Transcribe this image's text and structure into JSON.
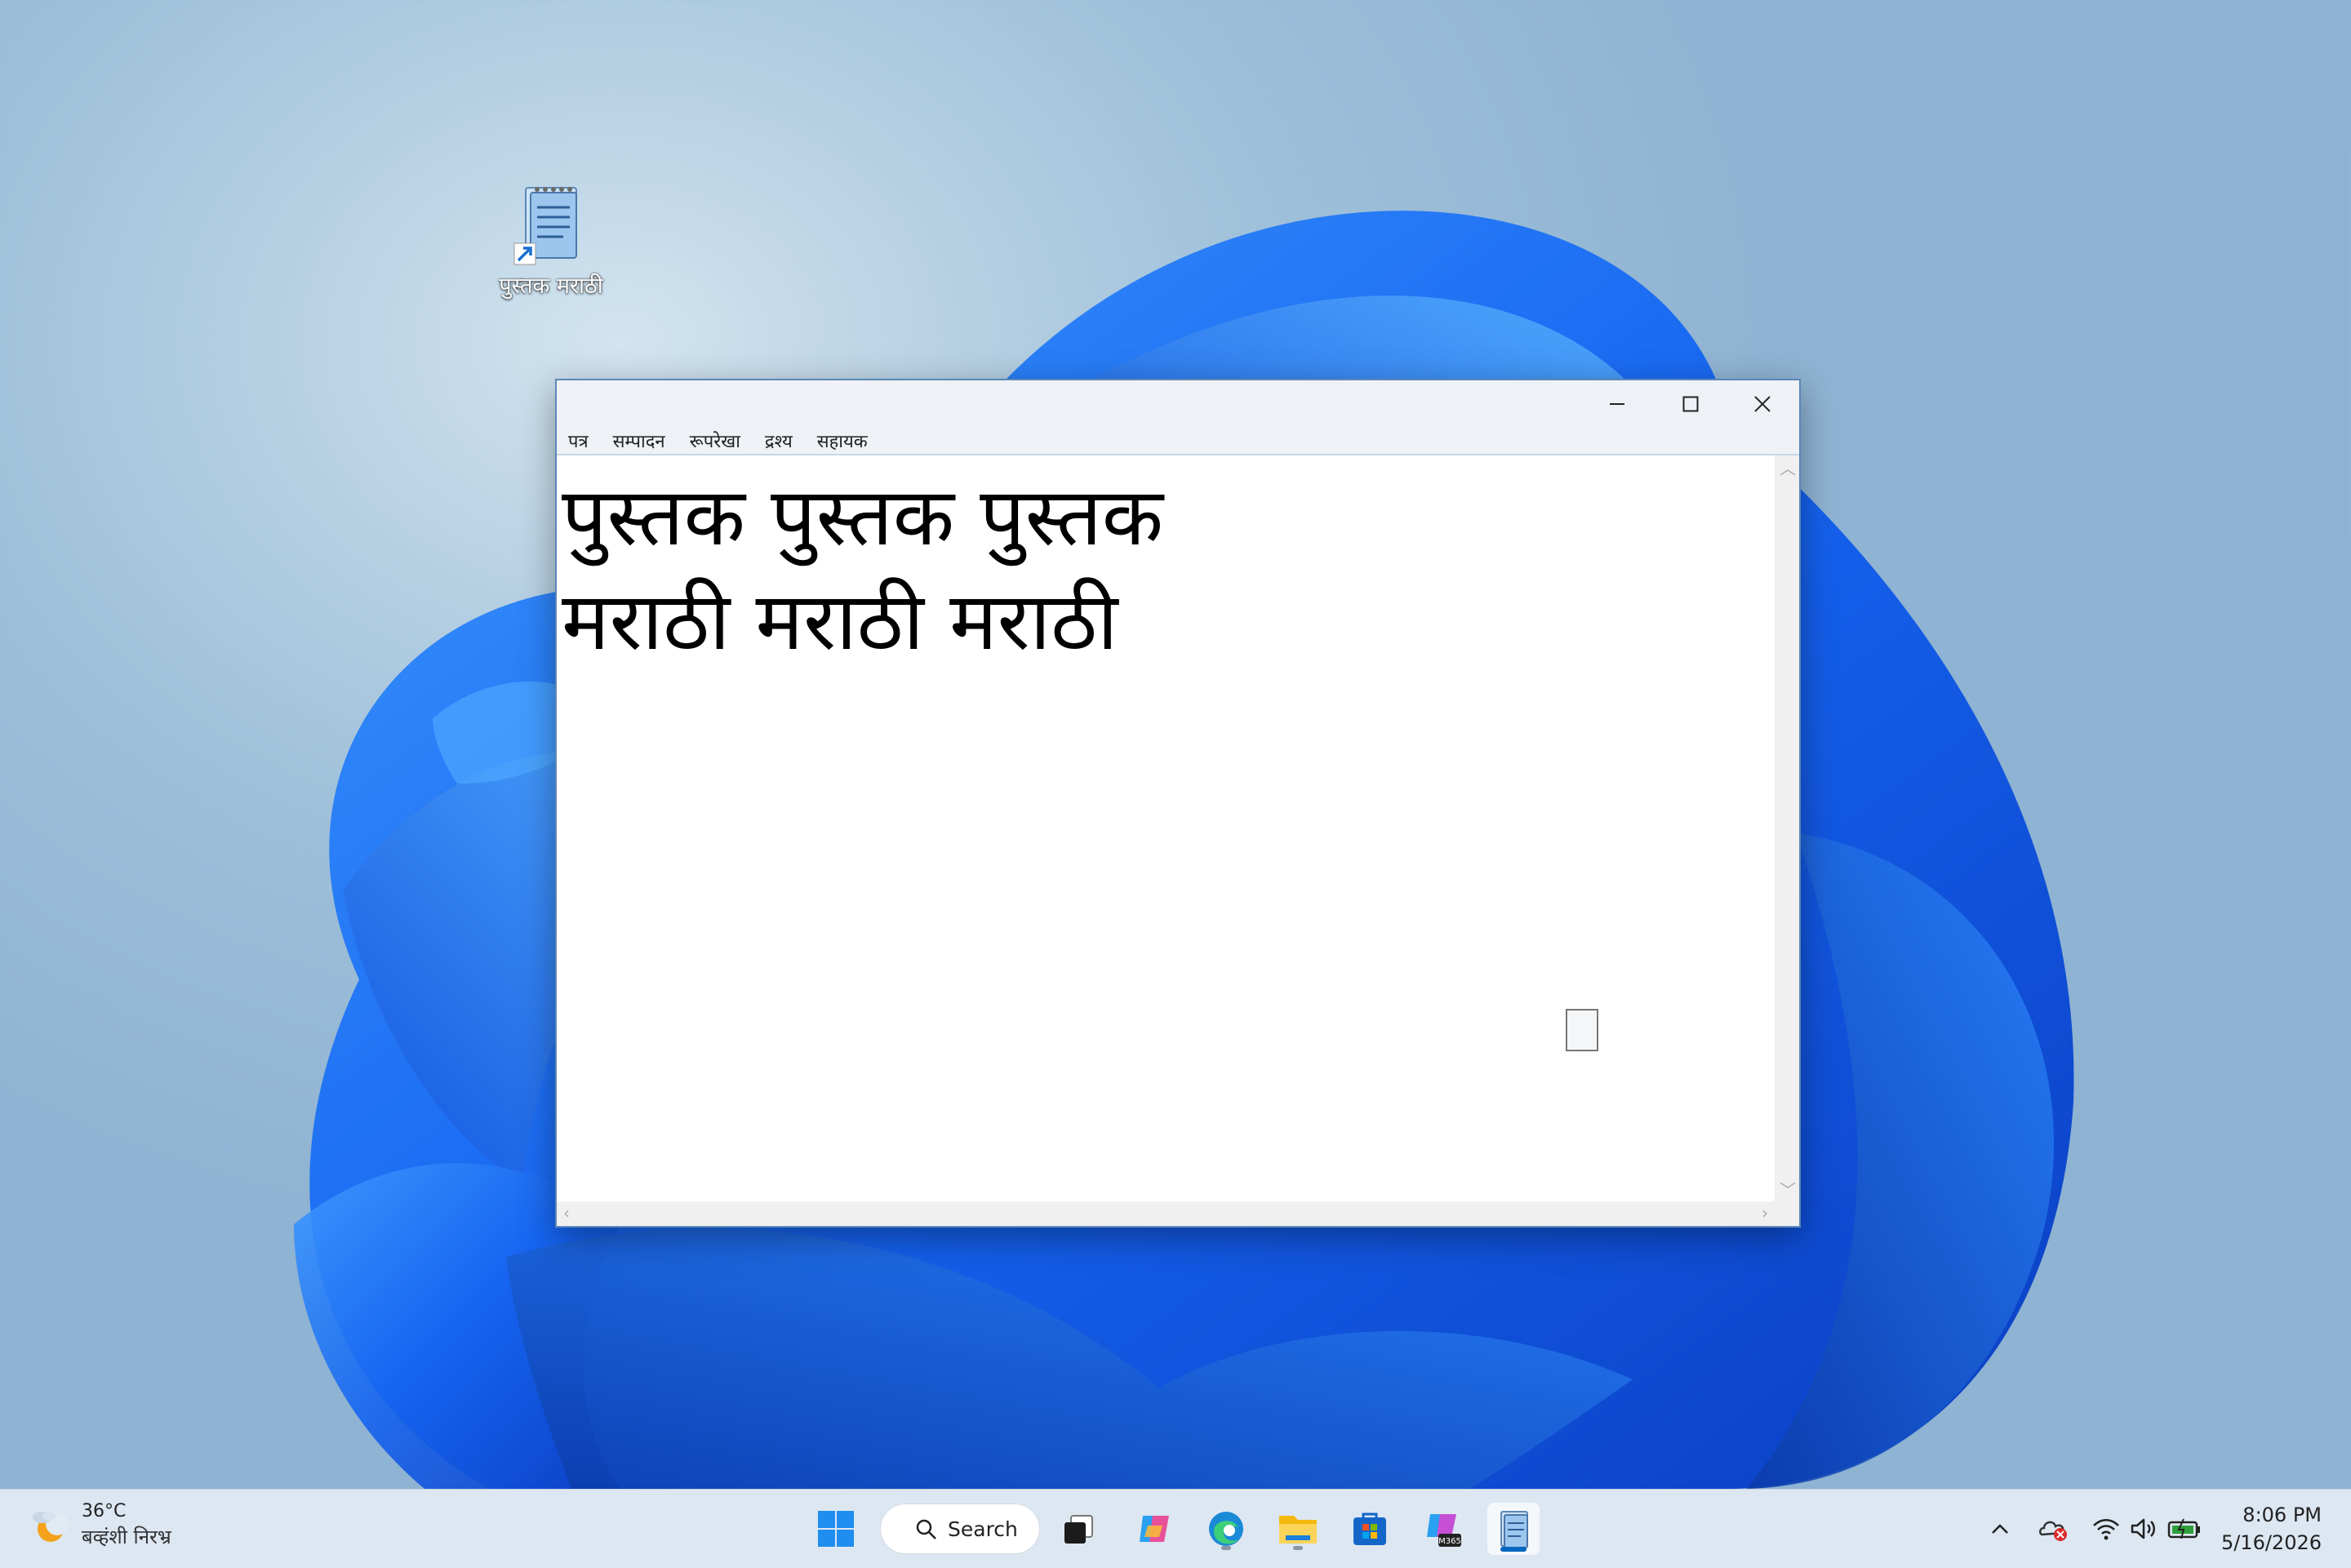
{
  "desktop": {
    "icon_label": "पुस्तक मराठी"
  },
  "window": {
    "menu": [
      "पत्र",
      "सम्पादन",
      "रूपरेखा",
      "द्रश्य",
      "सहायक"
    ],
    "content_lines": [
      "पुस्तक पुस्तक पुस्तक",
      "मराठी मराठी मराठी"
    ]
  },
  "taskbar": {
    "weather_temp": "36°C",
    "weather_desc": "बव्हंशी निरभ्र",
    "search_label": "Search",
    "time": "8:06 PM",
    "date": "5/16/2026"
  },
  "colors": {
    "accent": "#0067c0",
    "window_border": "#5b87b8",
    "taskbar_bg": "#e2eaf3"
  },
  "icons": [
    "notepad-shortcut-icon",
    "minimize-icon",
    "maximize-icon",
    "close-icon",
    "weather-moon-icon",
    "windows-start-icon",
    "search-icon",
    "task-view-icon",
    "copilot-icon",
    "edge-icon",
    "file-explorer-icon",
    "store-icon",
    "m365-icon",
    "notepad-icon",
    "chevron-up-icon",
    "onedrive-error-icon",
    "wifi-icon",
    "volume-icon",
    "battery-icon"
  ]
}
